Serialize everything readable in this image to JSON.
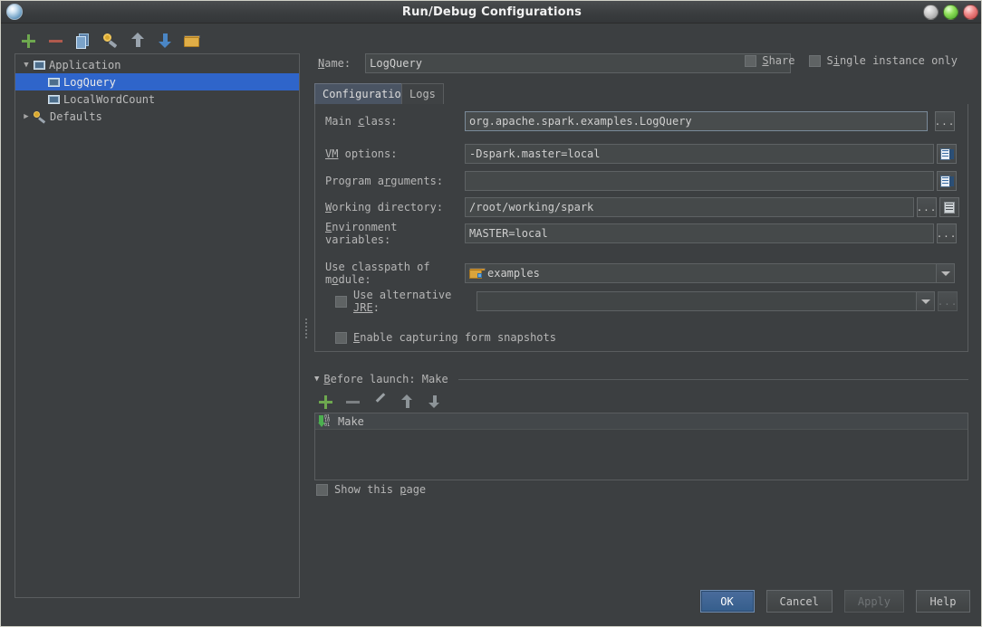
{
  "window": {
    "title": "Run/Debug Configurations",
    "app_icon": "intellij-icon",
    "controls": {
      "minimize": "minimize-button",
      "maximize": "maximize-button",
      "close": "close-button"
    }
  },
  "left_toolbar": {
    "items": [
      {
        "name": "add-configuration-button",
        "icon": "plus-icon",
        "tooltip": "Add New Configuration"
      },
      {
        "name": "remove-configuration-button",
        "icon": "minus-icon",
        "tooltip": "Remove Configuration"
      },
      {
        "name": "copy-configuration-button",
        "icon": "copy-icon",
        "tooltip": "Copy Configuration"
      },
      {
        "name": "edit-defaults-button",
        "icon": "wrench-icon",
        "tooltip": "Edit defaults"
      },
      {
        "name": "move-up-button",
        "icon": "arrow-up-icon",
        "tooltip": "Move Up"
      },
      {
        "name": "move-down-button",
        "icon": "arrow-down-icon",
        "tooltip": "Move Down"
      },
      {
        "name": "create-folder-button",
        "icon": "folder-icon",
        "tooltip": "Create New Folder"
      }
    ]
  },
  "tree": {
    "nodes": [
      {
        "label": "Application",
        "icon": "module-icon",
        "expanded": true,
        "twisty": "▼",
        "level": 0,
        "selected": false
      },
      {
        "label": "LogQuery",
        "icon": "module-icon",
        "level": 1,
        "selected": true
      },
      {
        "label": "LocalWordCount",
        "icon": "module-icon",
        "level": 1,
        "selected": false
      },
      {
        "label": "Defaults",
        "icon": "wrench-icon",
        "expanded": false,
        "twisty": "▶",
        "level": 0,
        "selected": false
      }
    ]
  },
  "header": {
    "name_label": "Name:",
    "name_label_mnemonic": "N",
    "name_value": "LogQuery",
    "share_label": "Share",
    "share_mnemonic": "S",
    "share_checked": false,
    "single_instance_label": "Single instance only",
    "single_instance_mnemonic": "i",
    "single_instance_checked": false
  },
  "tabs": [
    {
      "label": "Configuration",
      "active": true
    },
    {
      "label": "Logs",
      "active": false
    }
  ],
  "configuration": {
    "fields": [
      {
        "name": "main-class",
        "label_pre": "Main ",
        "label_mnemonic": "c",
        "label_post": "lass:",
        "value": "org.apache.spark.examples.LogQuery",
        "buttons": [
          "browse-ellipsis"
        ]
      },
      {
        "name": "vm-options",
        "label_pre": "",
        "label_mnemonic": "VM",
        "label_post": " options:",
        "value": "-Dspark.master=local",
        "buttons": [
          "expand-editor"
        ]
      },
      {
        "name": "program-arguments",
        "label_pre": "Program a",
        "label_mnemonic": "r",
        "label_post": "guments:",
        "value": "",
        "buttons": [
          "expand-editor"
        ]
      },
      {
        "name": "working-directory",
        "label_pre": "",
        "label_mnemonic": "W",
        "label_post": "orking directory:",
        "value": "/root/working/spark",
        "buttons": [
          "browse-ellipsis",
          "macro-list"
        ]
      },
      {
        "name": "environment-variables",
        "label_pre": "",
        "label_mnemonic": "E",
        "label_post": "nvironment variables:",
        "value": "MASTER=local",
        "buttons": [
          "browse-ellipsis"
        ]
      }
    ],
    "classpath": {
      "label_pre": "Use classpath of m",
      "label_mnemonic": "o",
      "label_post": "dule:",
      "value": "examples",
      "icon": "module-folder-icon"
    },
    "alternative_jre": {
      "label_pre": "Use alternative ",
      "label_mnemonic": "JRE",
      "label_post": ":",
      "checked": false,
      "value": "",
      "enabled": false
    },
    "form_snapshots": {
      "label_pre": "",
      "label_mnemonic": "E",
      "label_post": "nable capturing form snapshots",
      "checked": false
    }
  },
  "before_launch": {
    "header": "Before launch: Make",
    "header_mnemonic": "B",
    "twisty": "▼",
    "toolbar": [
      {
        "name": "add-task-button",
        "icon": "plus-icon"
      },
      {
        "name": "remove-task-button",
        "icon": "minus-icon"
      },
      {
        "name": "edit-task-button",
        "icon": "pencil-icon"
      },
      {
        "name": "move-task-up-button",
        "icon": "arrow-up-icon"
      },
      {
        "name": "move-task-down-button",
        "icon": "arrow-down-icon"
      }
    ],
    "tasks": [
      {
        "label": "Make",
        "icon": "make-compile-icon",
        "bits": [
          "01",
          "10",
          "01"
        ]
      }
    ],
    "show_page_label": "Show this page",
    "show_page_mnemonic": "p",
    "show_page_checked": false
  },
  "footer": {
    "buttons": [
      {
        "name": "ok-button",
        "label": "OK",
        "style": "default",
        "enabled": true
      },
      {
        "name": "cancel-button",
        "label": "Cancel",
        "style": "normal",
        "enabled": true
      },
      {
        "name": "apply-button",
        "label": "Apply",
        "style": "normal",
        "enabled": false
      },
      {
        "name": "help-button",
        "label": "Help",
        "style": "normal",
        "enabled": true
      }
    ]
  },
  "colors": {
    "window_bg": "#3c3f41",
    "field_bg": "#45494a",
    "selection_blue": "#2f65ca",
    "accent_green": "#6ea84f",
    "accent_red": "#b05a4d",
    "text": "#b6b6b6",
    "default_button": "#4a6c9c"
  }
}
